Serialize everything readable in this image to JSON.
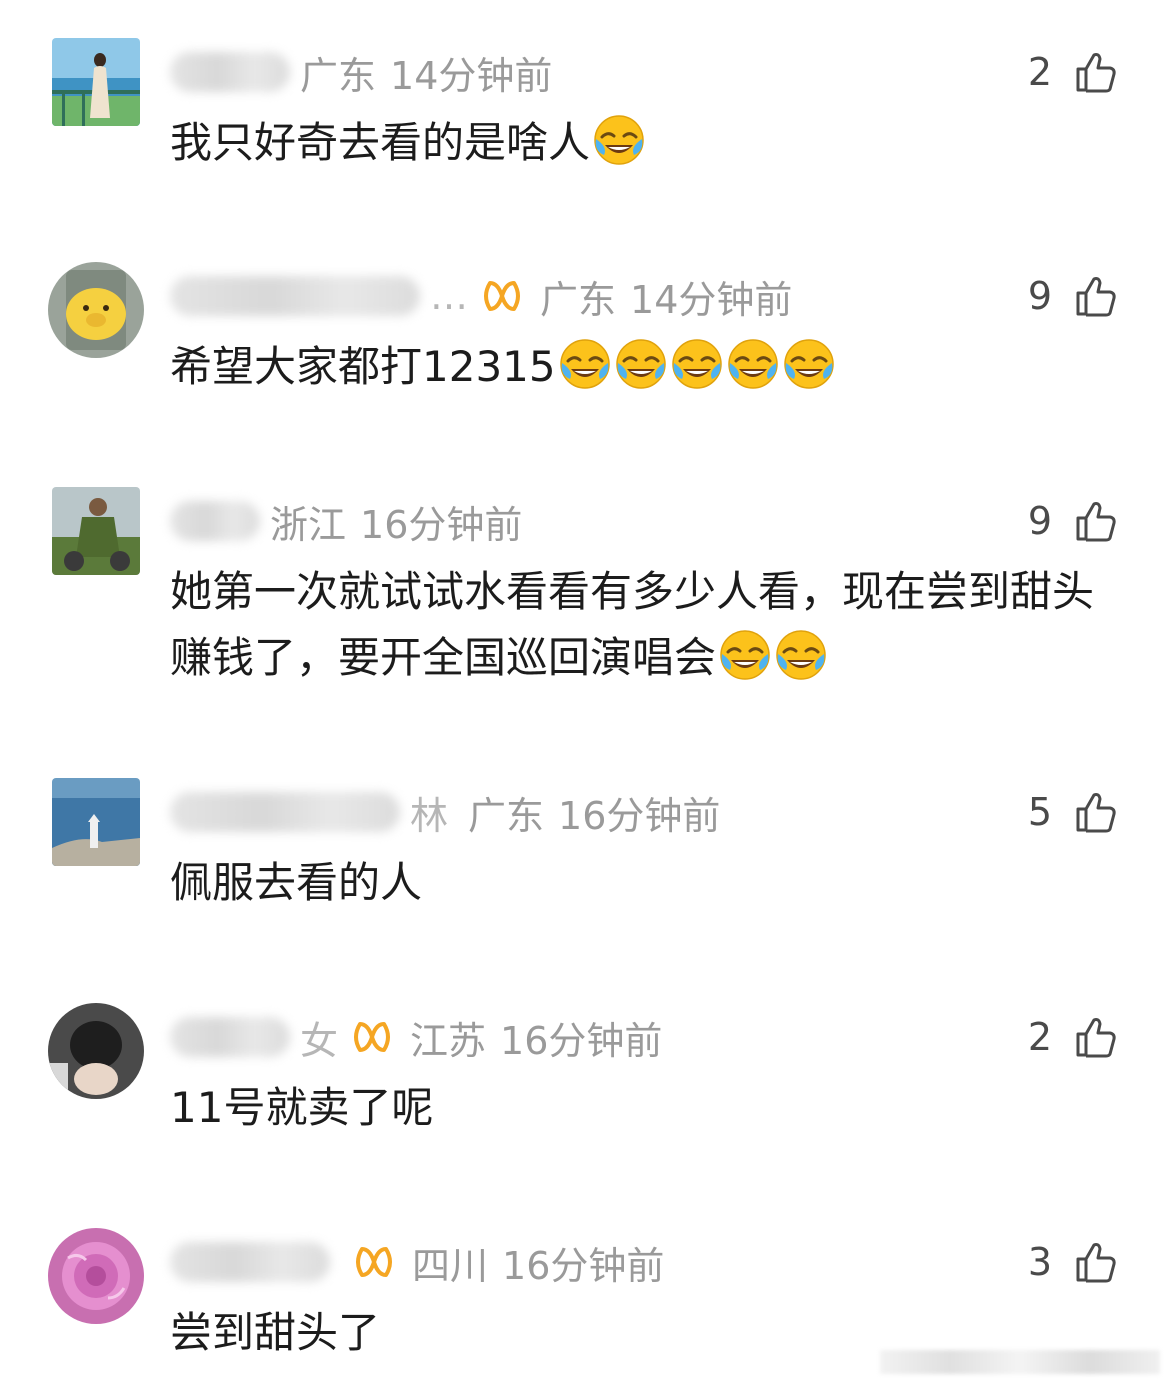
{
  "comments": [
    {
      "name_visible": "",
      "region": "广东",
      "time": "14分钟前",
      "likes": "2",
      "text": "我只好奇去看的是啥人",
      "emoji_count": 1,
      "has_vip": false
    },
    {
      "name_visible": "…",
      "region": "广东",
      "time": "14分钟前",
      "likes": "9",
      "text": "希望大家都打12315",
      "emoji_count": 5,
      "has_vip": true
    },
    {
      "name_visible": "",
      "region": "浙江",
      "time": "16分钟前",
      "likes": "9",
      "text": "她第一次就试试水看看有多少人看，现在尝到甜头赚钱了，要开全国巡回演唱会",
      "emoji_count": 2,
      "has_vip": false
    },
    {
      "name_visible": "林",
      "region": "广东",
      "time": "16分钟前",
      "likes": "5",
      "text": "佩服去看的人",
      "emoji_count": 0,
      "has_vip": false
    },
    {
      "name_visible": "女",
      "region": "江苏",
      "time": "16分钟前",
      "likes": "2",
      "text": "11号就卖了呢",
      "emoji_count": 0,
      "has_vip": true
    },
    {
      "name_visible": "",
      "region": "四川",
      "time": "16分钟前",
      "likes": "3",
      "text": "尝到甜头了",
      "emoji_count": 0,
      "has_vip": true
    }
  ],
  "icons": {
    "emoji": "laughing-crying-emoji-icon",
    "like": "thumbs-up-icon",
    "vip": "vip-badge-icon"
  },
  "colors": {
    "meta": "#9a9a9a",
    "text": "#1c1c1c",
    "vip": "#f5a623",
    "emoji_face": "#fcc21b"
  }
}
